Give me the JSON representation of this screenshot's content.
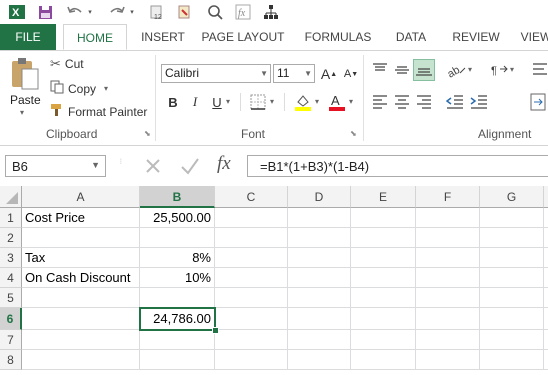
{
  "qat": {
    "icons": [
      "save-icon",
      "undo-icon",
      "redo-icon",
      "paste-values-icon",
      "format-painter-icon",
      "print-preview-icon",
      "insert-function-icon",
      "hierarchy-icon"
    ]
  },
  "tabs": [
    {
      "label": "FILE"
    },
    {
      "label": "HOME"
    },
    {
      "label": "INSERT"
    },
    {
      "label": "PAGE LAYOUT"
    },
    {
      "label": "FORMULAS"
    },
    {
      "label": "DATA"
    },
    {
      "label": "REVIEW"
    },
    {
      "label": "VIEW"
    }
  ],
  "clipboard": {
    "paste_label": "Paste",
    "cut_label": "Cut",
    "copy_label": "Copy",
    "format_painter_label": "Format Painter",
    "group_label": "Clipboard"
  },
  "font": {
    "name": "Calibri",
    "size": "11",
    "group_label": "Font",
    "bold": "B",
    "italic": "I",
    "underline": "U",
    "grow": "A",
    "shrink": "A",
    "font_color": "#e81123",
    "fill_color": "#ffff00"
  },
  "alignment": {
    "group_label": "Alignment"
  },
  "formula_bar": {
    "name_box": "B6",
    "fx": "fx",
    "formula": "=B1*(1+B3)*(1-B4)"
  },
  "sheet": {
    "columns": [
      "A",
      "B",
      "C",
      "D",
      "E",
      "F",
      "G"
    ],
    "rows": [
      "1",
      "2",
      "3",
      "4",
      "5",
      "6",
      "7",
      "8"
    ],
    "cells": {
      "A1": "Cost Price",
      "B1": "25,500.00",
      "A3": "Tax",
      "B3": "8%",
      "A4": "On Cash Discount",
      "B4": "10%",
      "B6": "24,786.00"
    },
    "selected_cell": "B6"
  },
  "colors": {
    "accent": "#217346"
  }
}
